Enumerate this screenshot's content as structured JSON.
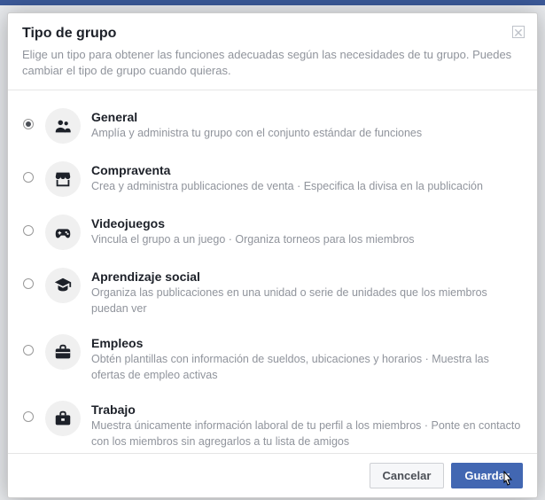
{
  "header": {
    "title": "Tipo de grupo",
    "subtitle": "Elige un tipo para obtener las funciones adecuadas según las necesidades de tu grupo. Puedes cambiar el tipo de grupo cuando quieras."
  },
  "options": [
    {
      "icon": "people-icon",
      "title": "General",
      "desc": "Amplía y administra tu grupo con el conjunto estándar de funciones",
      "selected": true
    },
    {
      "icon": "storefront-icon",
      "title": "Compraventa",
      "desc": "Crea y administra publicaciones de venta · Especifica la divisa en la publicación",
      "selected": false
    },
    {
      "icon": "gamepad-icon",
      "title": "Videojuegos",
      "desc": "Vincula el grupo a un juego · Organiza torneos para los miembros",
      "selected": false
    },
    {
      "icon": "graduation-icon",
      "title": "Aprendizaje social",
      "desc": "Organiza las publicaciones en una unidad o serie de unidades que los miembros puedan ver",
      "selected": false
    },
    {
      "icon": "briefcase-icon",
      "title": "Empleos",
      "desc": "Obtén plantillas con información de sueldos, ubicaciones y horarios · Muestra las ofertas de empleo activas",
      "selected": false
    },
    {
      "icon": "work-briefcase-icon",
      "title": "Trabajo",
      "desc": "Muestra únicamente información laboral de tu perfil a los miembros · Ponte en contacto con los miembros sin agregarlos a tu lista de amigos",
      "selected": false
    }
  ],
  "footer": {
    "cancel": "Cancelar",
    "save": "Guardar"
  }
}
